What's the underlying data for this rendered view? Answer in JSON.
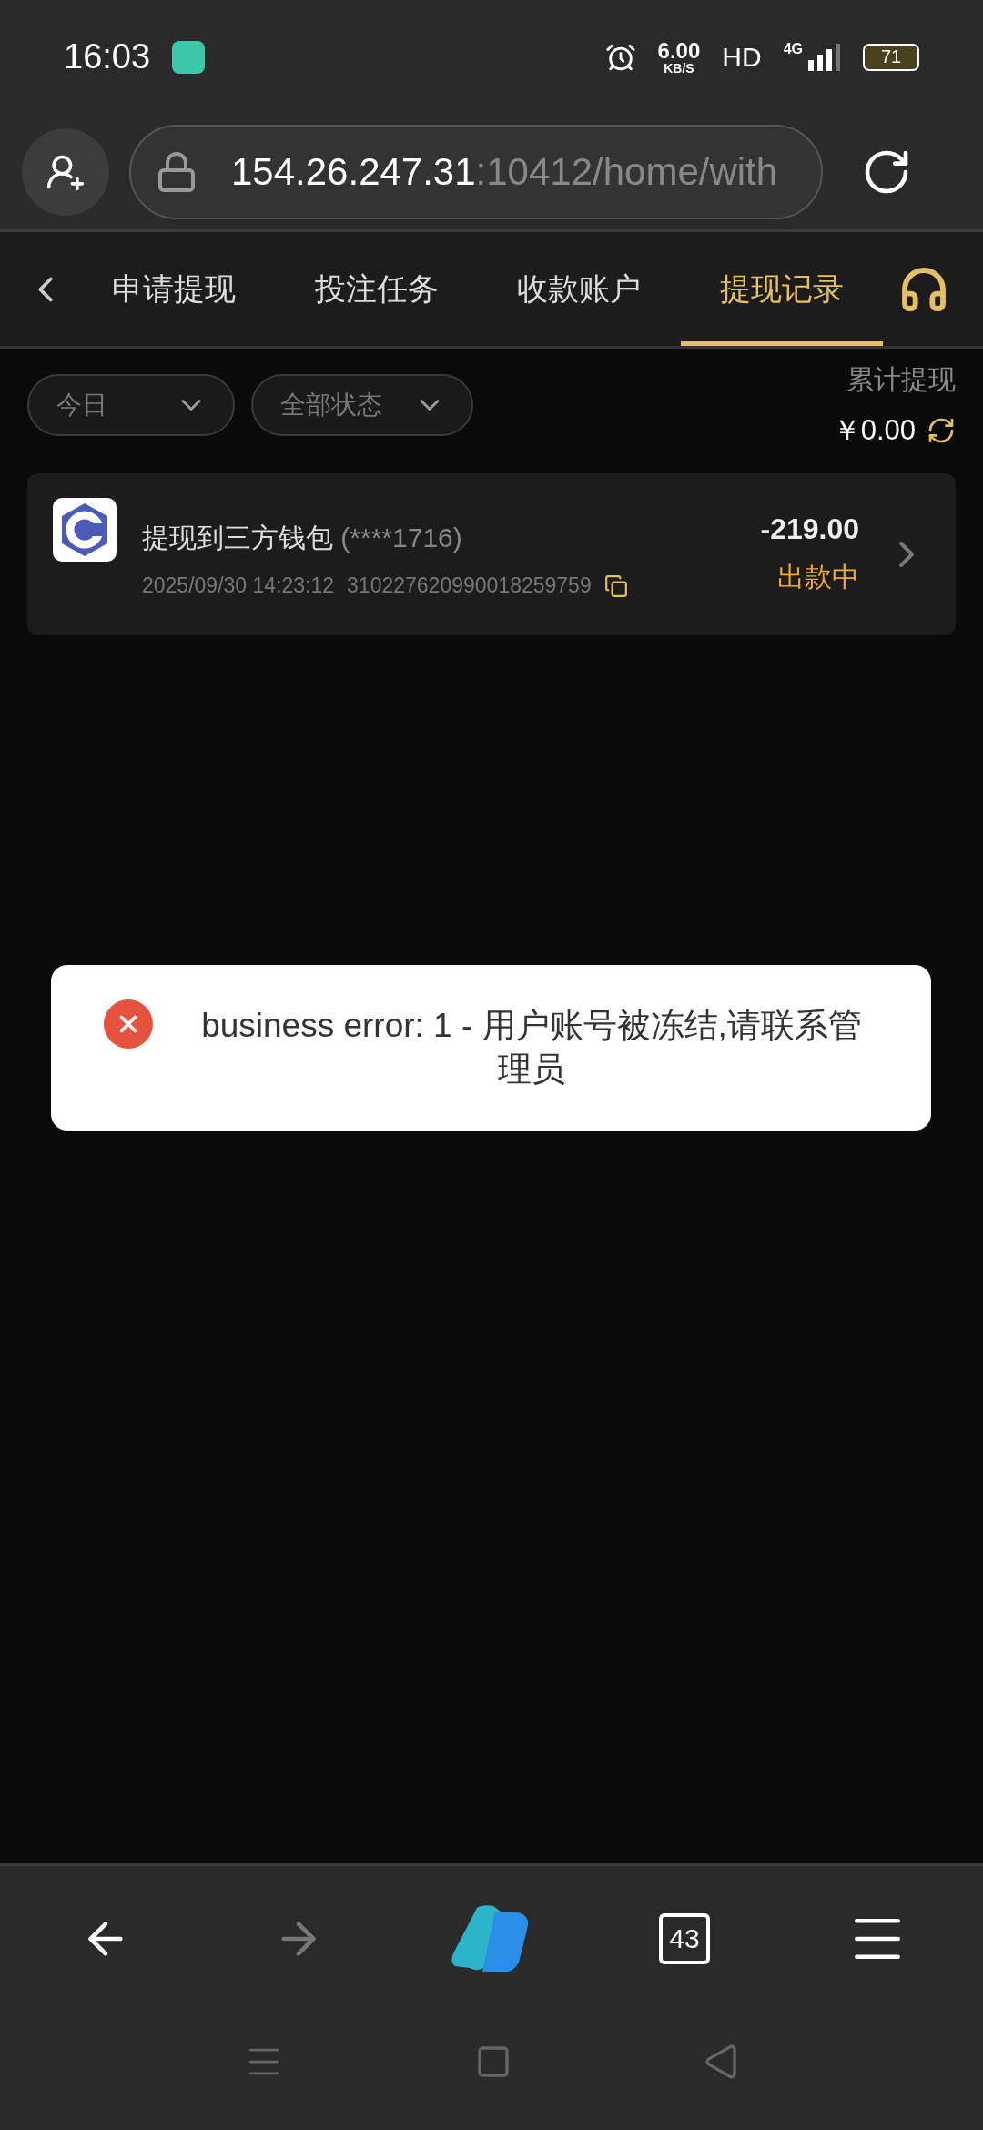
{
  "status_bar": {
    "time": "16:03",
    "speed": "6.00",
    "speed_unit": "KB/S",
    "hd": "HD",
    "network": "4G",
    "battery": "71"
  },
  "address_bar": {
    "host": "154.26.247.31",
    "path": ":10412/home/with"
  },
  "tabs": [
    {
      "label": "申请提现",
      "selected": false
    },
    {
      "label": "投注任务",
      "selected": false
    },
    {
      "label": "收款账户",
      "selected": false
    },
    {
      "label": "提现记录",
      "selected": true
    }
  ],
  "filters": [
    {
      "label": "今日"
    },
    {
      "label": "全部状态"
    }
  ],
  "total": {
    "label": "累计提现",
    "amount": "￥0.00"
  },
  "records": [
    {
      "title": "提现到三方钱包",
      "account": "(****1716)",
      "time": "2025/09/30 14:23:12",
      "order_id": "310227620990018259759",
      "amount": "-219.00",
      "status": "出款中"
    }
  ],
  "toast": {
    "kind": "error",
    "message": "business error: 1 - 用户账号被冻结,请联系管理员"
  },
  "browser_nav": {
    "back_disabled": false,
    "forward_disabled": true,
    "tab_count": "43"
  }
}
